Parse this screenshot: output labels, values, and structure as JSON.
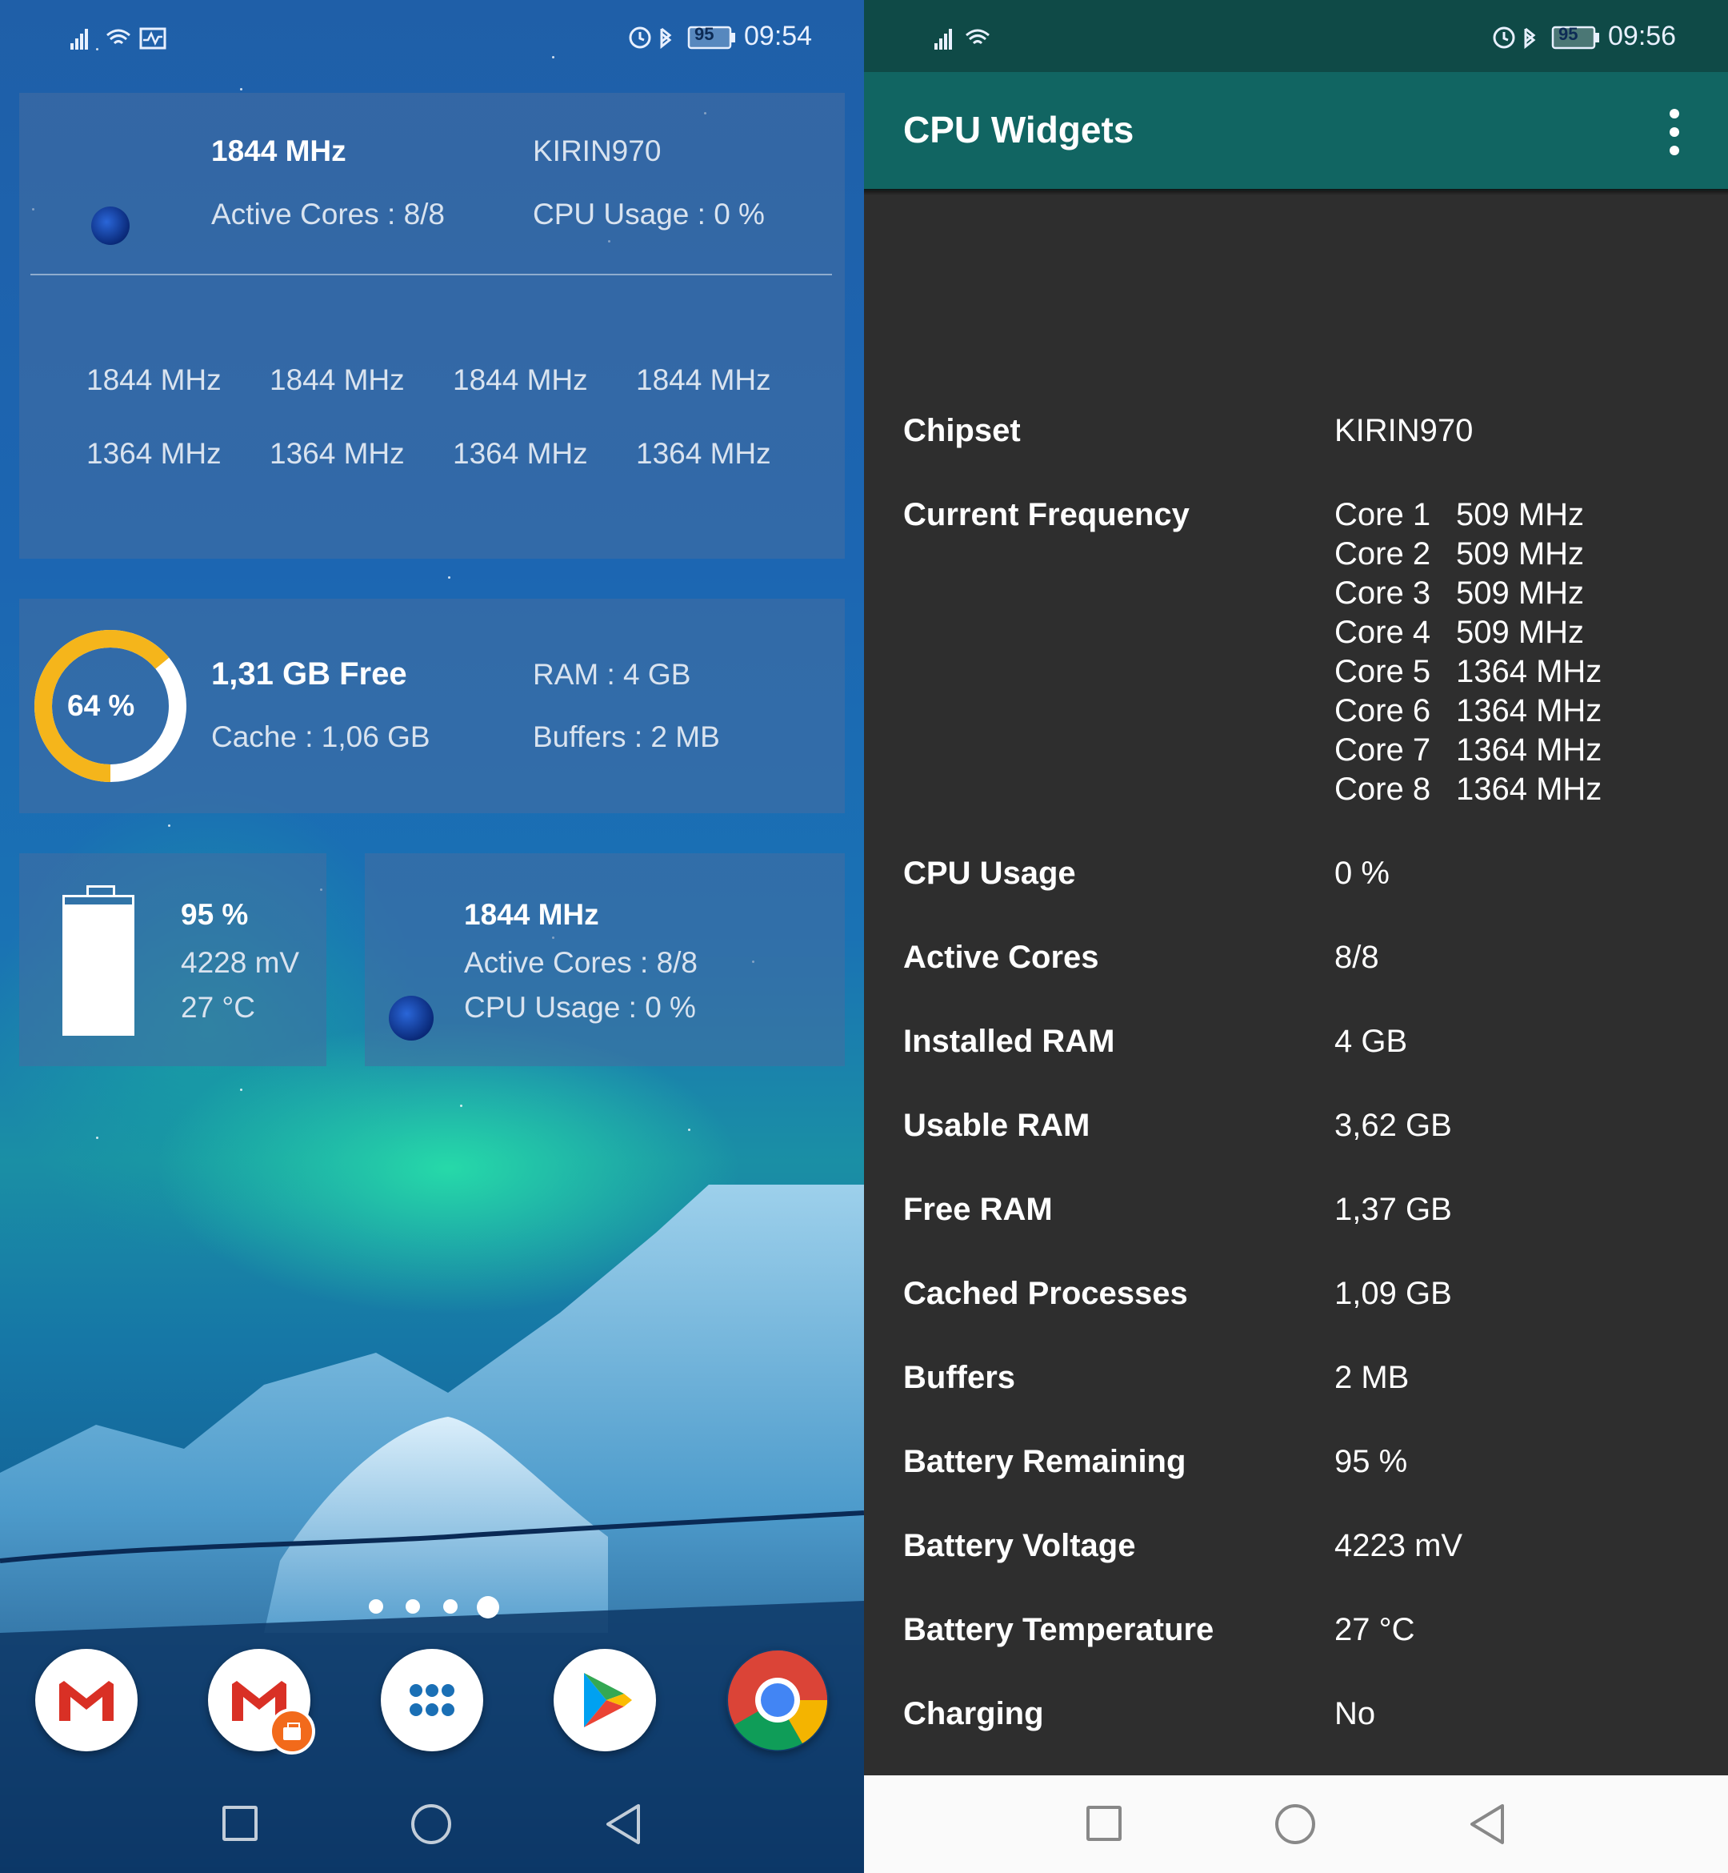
{
  "left": {
    "status": {
      "time": "09:54",
      "battery": "95"
    },
    "cpu_widget": {
      "freq": "1844 MHz",
      "chipset": "KIRIN970",
      "active_cores": "Active Cores : 8/8",
      "cpu_usage": "CPU Usage : 0 %",
      "cores_row1": [
        "1844 MHz",
        "1844 MHz",
        "1844 MHz",
        "1844 MHz"
      ],
      "cores_row2": [
        "1364 MHz",
        "1364 MHz",
        "1364 MHz",
        "1364 MHz"
      ]
    },
    "ram_widget": {
      "percent": "64 %",
      "percent_value": 64,
      "free": "1,31 GB Free",
      "ram": "RAM : 4 GB",
      "cache": "Cache : 1,06 GB",
      "buffers": "Buffers : 2 MB"
    },
    "battery_widget": {
      "percent": "95 %",
      "level": 0.95,
      "voltage": "4228 mV",
      "temperature": "27 °C"
    },
    "small_cpu_widget": {
      "freq": "1844 MHz",
      "active_cores": "Active Cores : 8/8",
      "cpu_usage": "CPU Usage : 0 %"
    },
    "page_indicator": {
      "count": 4,
      "active": 3
    },
    "dock": [
      "gmail-icon",
      "gmail-work-icon",
      "app-drawer-icon",
      "play-store-icon",
      "chrome-icon"
    ]
  },
  "right": {
    "status": {
      "time": "09:56",
      "battery": "95"
    },
    "title": "CPU Widgets",
    "rows": {
      "chipset": {
        "label": "Chipset",
        "value": "KIRIN970"
      },
      "current_frequency": {
        "label": "Current Frequency"
      },
      "cores": [
        {
          "name": "Core 1",
          "freq": "509 MHz"
        },
        {
          "name": "Core 2",
          "freq": "509 MHz"
        },
        {
          "name": "Core 3",
          "freq": "509 MHz"
        },
        {
          "name": "Core 4",
          "freq": "509 MHz"
        },
        {
          "name": "Core 5",
          "freq": "1364 MHz"
        },
        {
          "name": "Core 6",
          "freq": "1364 MHz"
        },
        {
          "name": "Core 7",
          "freq": "1364 MHz"
        },
        {
          "name": "Core 8",
          "freq": "1364 MHz"
        }
      ],
      "cpu_usage": {
        "label": "CPU Usage",
        "value": "0 %"
      },
      "active_cores": {
        "label": "Active Cores",
        "value": "8/8"
      },
      "installed_ram": {
        "label": "Installed RAM",
        "value": "4 GB"
      },
      "usable_ram": {
        "label": "Usable RAM",
        "value": "3,62 GB"
      },
      "free_ram": {
        "label": "Free RAM",
        "value": "1,37 GB"
      },
      "cached_processes": {
        "label": "Cached Processes",
        "value": "1,09 GB"
      },
      "buffers": {
        "label": "Buffers",
        "value": "2 MB"
      },
      "battery_remaining": {
        "label": "Battery Remaining",
        "value": "95 %"
      },
      "battery_voltage": {
        "label": "Battery Voltage",
        "value": "4223 mV"
      },
      "battery_temperature": {
        "label": "Battery Temperature",
        "value": "27 °C"
      },
      "charging": {
        "label": "Charging",
        "value": "No"
      }
    }
  },
  "colors": {
    "appbar": "#116562",
    "statusbar": "#0f4a47",
    "ram_ring": "#f5b51b",
    "content_bg": "#2e2e2e"
  }
}
